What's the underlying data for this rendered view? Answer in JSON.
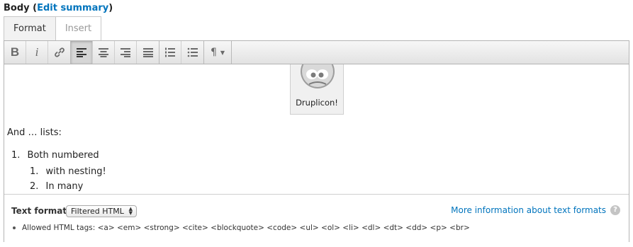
{
  "field": {
    "label": "Body",
    "open_paren": "(",
    "edit_summary": "Edit summary",
    "close_paren": ")"
  },
  "tabs": [
    {
      "label": "Format",
      "active": true
    },
    {
      "label": "Insert",
      "active": false
    }
  ],
  "toolbar": {
    "buttons": [
      "bold",
      "italic",
      "link",
      "align-left",
      "align-center",
      "align-right",
      "align-justify",
      "numbered-list",
      "bullet-list",
      "paragraph-format"
    ],
    "bold_glyph": "B",
    "italic_glyph": "i",
    "paragraph_glyph": "¶",
    "caret_glyph": "▼",
    "active_button": "align-left"
  },
  "content": {
    "image_caption": "Druplicon!",
    "paragraph": "And … lists:",
    "list": {
      "item1": {
        "marker": "1.",
        "text": "Both numbered"
      },
      "nested": [
        {
          "marker": "1.",
          "text": "with nesting!"
        },
        {
          "marker": "2.",
          "text": "In many"
        }
      ]
    }
  },
  "text_format": {
    "label": "Text format",
    "selected": "Filtered HTML",
    "more_info": "More information about text formats",
    "help_glyph": "?",
    "allowed_tags": "Allowed HTML tags: <a> <em> <strong> <cite> <blockquote> <code> <ul> <ol> <li> <dl> <dt> <dd> <p> <br>"
  },
  "colors": {
    "link": "#0074bd",
    "toolbar_bg": "#e8e8e8",
    "border": "#b4b4b4"
  }
}
